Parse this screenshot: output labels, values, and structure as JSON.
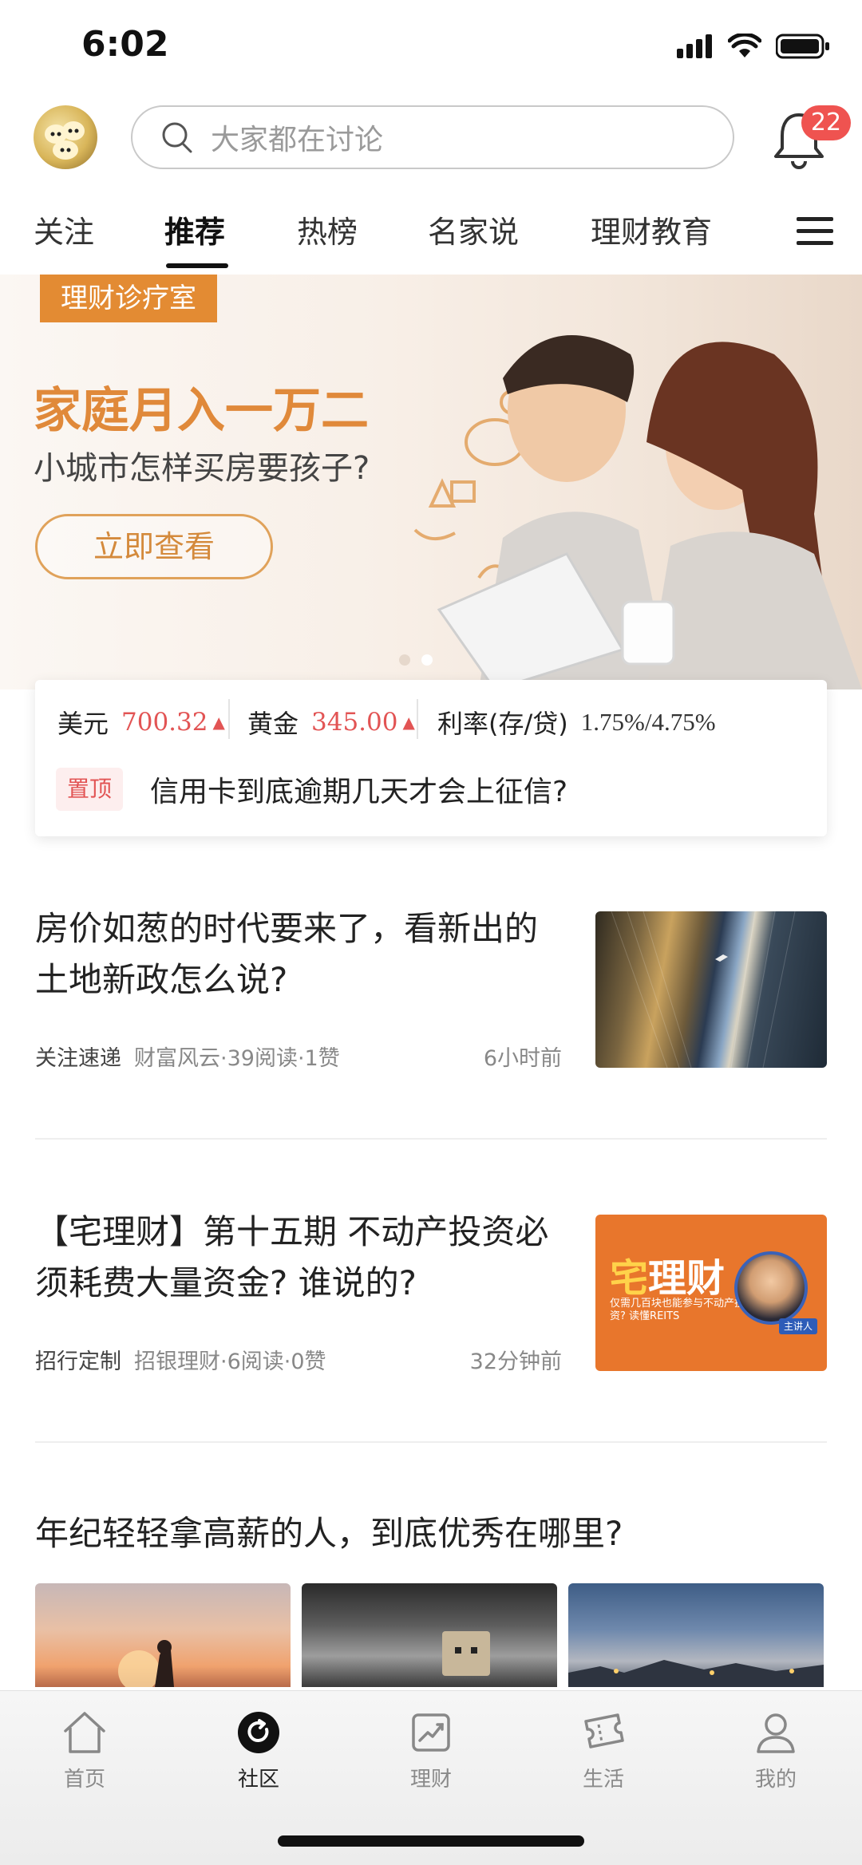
{
  "status": {
    "time": "6:02"
  },
  "header": {
    "search_placeholder": "大家都在讨论",
    "notification_count": "22"
  },
  "tabs": [
    {
      "label": "关注"
    },
    {
      "label": "推荐",
      "active": true
    },
    {
      "label": "热榜"
    },
    {
      "label": "名家说"
    },
    {
      "label": "理财教育"
    }
  ],
  "banner": {
    "tag": "理财诊疗室",
    "title": "家庭月入一万二",
    "subtitle": "小城市怎样买房要孩子?",
    "button": "立即查看",
    "slide_count": 2,
    "active_slide": 2
  },
  "market": {
    "usd": {
      "label": "美元",
      "value": "700.32",
      "trend": "▲"
    },
    "gold": {
      "label": "黄金",
      "value": "345.00",
      "trend": "▲"
    },
    "rate": {
      "label": "利率(存/贷)",
      "value": "1.75%/4.75%"
    },
    "pinned": {
      "badge": "置顶",
      "text": "信用卡到底逾期几天才会上征信?"
    }
  },
  "articles": [
    {
      "title": "房价如葱的时代要来了，看新出的土地新政怎么说?",
      "source_tag": "关注速递",
      "meta": "财富风云·39阅读·1赞",
      "time": "6小时前"
    },
    {
      "title": "【宅理财】第十五期 不动产投资必须耗费大量资金? 谁说的?",
      "source_tag": "招行定制",
      "meta": "招银理财·6阅读·0赞",
      "time": "32分钟前",
      "thumb": {
        "title_a": "宅",
        "title_b": "理财",
        "caption": "仅需几百块也能参与不动产投资? 读懂REITS",
        "badge": "主讲人"
      }
    },
    {
      "title": "年纪轻轻拿高薪的人，到底优秀在哪里?"
    }
  ],
  "tabbar": [
    {
      "label": "首页",
      "icon": "home-icon"
    },
    {
      "label": "社区",
      "icon": "community-icon",
      "active": true
    },
    {
      "label": "理财",
      "icon": "finance-chart-icon"
    },
    {
      "label": "生活",
      "icon": "ticket-icon"
    },
    {
      "label": "我的",
      "icon": "person-icon"
    }
  ],
  "colors": {
    "accent": "#e0893a",
    "alert": "#ef5350",
    "price_up": "#e25454"
  }
}
